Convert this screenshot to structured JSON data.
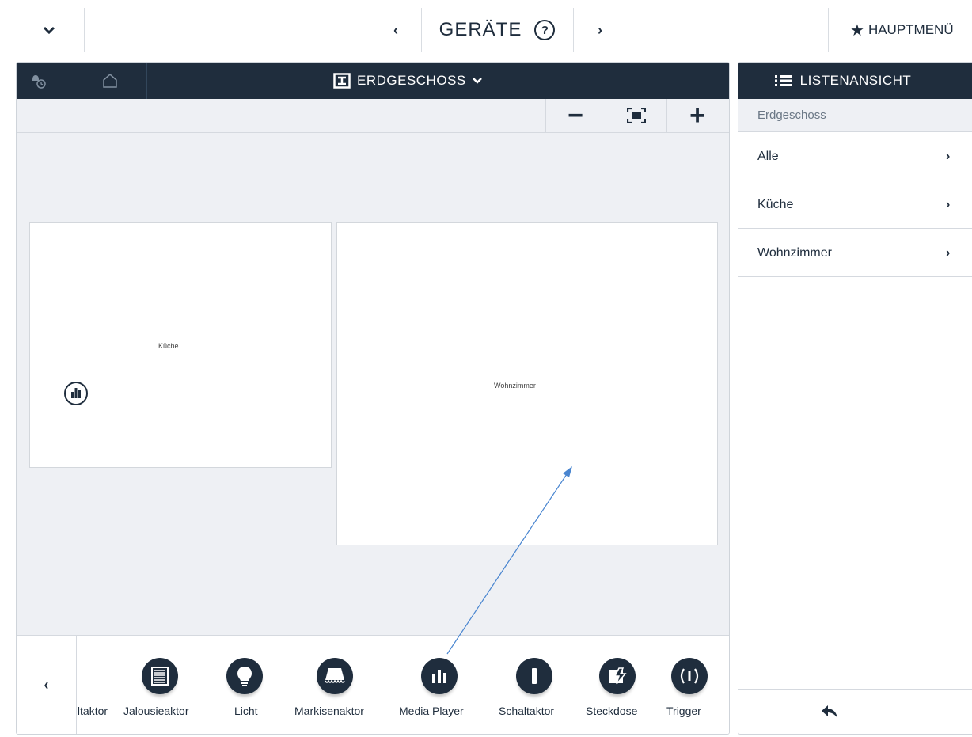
{
  "topbar": {
    "title": "GERÄTE",
    "help_glyph": "?",
    "main_menu_label": "HAUPTMENÜ",
    "prev_glyph": "‹",
    "next_glyph": "›",
    "collapse_icon": "chevron-down-icon",
    "menu_icon": "star-icon"
  },
  "floorplan": {
    "title": "ERDGESCHOSS",
    "zoom_out_glyph": "−",
    "zoom_in_glyph": "+",
    "rooms": [
      {
        "label": "Küche"
      },
      {
        "label": "Wohnzimmer"
      }
    ]
  },
  "device_bar": {
    "prev_glyph": "‹",
    "devices": [
      {
        "label": "Schaltaktor",
        "icon": "actuator-icon"
      },
      {
        "label": "Jalousieaktor",
        "icon": "blind-icon"
      },
      {
        "label": "Licht",
        "icon": "bulb-icon"
      },
      {
        "label": "Markisenaktor",
        "icon": "awning-icon"
      },
      {
        "label": "Media Player",
        "icon": "media-player-icon"
      },
      {
        "label": "Schaltaktor",
        "icon": "switch-icon"
      },
      {
        "label": "Steckdose",
        "icon": "socket-icon"
      },
      {
        "label": "Trigger",
        "icon": "trigger-icon"
      }
    ]
  },
  "side": {
    "header": "LISTENANSICHT",
    "subheader": "Erdgeschoss",
    "items": [
      {
        "label": "Alle"
      },
      {
        "label": "Küche"
      },
      {
        "label": "Wohnzimmer"
      }
    ],
    "item_glyph": "›"
  },
  "colors": {
    "dark": "#1f2d3d",
    "panel": "#eef0f4",
    "arrow": "#4a86d0"
  }
}
